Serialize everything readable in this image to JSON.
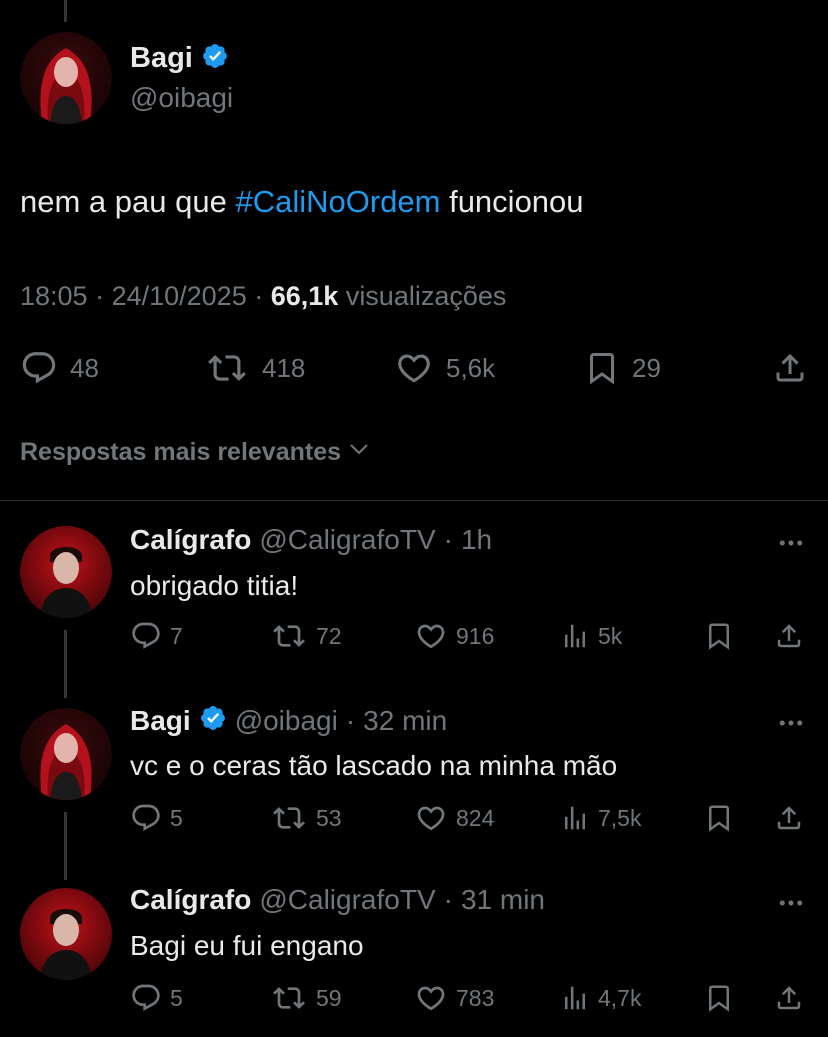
{
  "main_tweet": {
    "author_name": "Bagi",
    "author_handle": "@oibagi",
    "verified": true,
    "text_before": "nem a pau que ",
    "hashtag": "#CaliNoOrdem",
    "text_after": " funcionou",
    "time": "18:05",
    "date": "24/10/2025",
    "views": "66,1k",
    "views_label": "visualizações",
    "replies": "48",
    "reposts": "418",
    "likes": "5,6k",
    "bookmarks": "29"
  },
  "sort": {
    "label": "Respostas mais relevantes"
  },
  "replies": [
    {
      "author_name": "Calígrafo",
      "author_handle": "@CaligrafoTV",
      "time": "1h",
      "verified": false,
      "text": "obrigado titia!",
      "replies": "7",
      "reposts": "72",
      "likes": "916",
      "views": "5k"
    },
    {
      "author_name": "Bagi",
      "author_handle": "@oibagi",
      "time": "32 min",
      "verified": true,
      "text": "vc e o ceras tão lascado na minha mão",
      "replies": "5",
      "reposts": "53",
      "likes": "824",
      "views": "7,5k"
    },
    {
      "author_name": "Calígrafo",
      "author_handle": "@CaligrafoTV",
      "time": "31 min",
      "verified": false,
      "text": "Bagi eu fui engano",
      "replies": "5",
      "reposts": "59",
      "likes": "783",
      "views": "4,7k"
    }
  ],
  "colors": {
    "background": "#000000",
    "text_primary": "#e7e9ea",
    "text_secondary": "#71767b",
    "accent": "#1d9bf0",
    "divider": "#2f3336"
  },
  "icons": [
    "reply-icon",
    "repost-icon",
    "like-icon",
    "bookmark-icon",
    "share-icon",
    "views-icon",
    "more-icon",
    "verified-badge-icon",
    "chevron-down-icon"
  ]
}
